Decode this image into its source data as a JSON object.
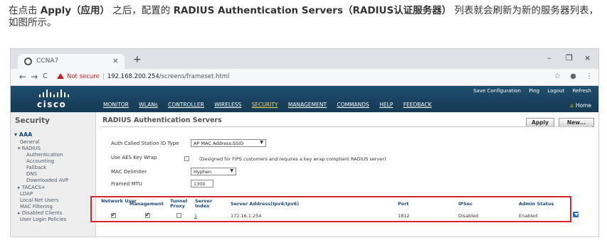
{
  "intro": {
    "p1": "在点击 ",
    "apply": "Apply（应用）",
    "p2": " 之后，配置的 ",
    "servers": "RADIUS Authentication Servers（RADIUS认证服务器）",
    "p3": " 列表就会刷新为新的服务器列表，如图所示。"
  },
  "browser": {
    "tab_title": "CCNA7",
    "tab_close": "×",
    "new_tab": "+",
    "minimize": "–",
    "restore": "❐",
    "close": "×",
    "back": "←",
    "forward": "→",
    "reload": "C",
    "not_secure": "Not secure",
    "url_host": "192.168.200.254",
    "url_path": "/screens/frameset.html",
    "star": "☆",
    "menu": "⋮"
  },
  "cisco": {
    "logo_text": "cisco",
    "menu": [
      "MONITOR",
      "WLANs",
      "CONTROLLER",
      "WIRELESS",
      "SECURITY",
      "MANAGEMENT",
      "COMMANDS",
      "HELP",
      "FEEDBACK"
    ],
    "active_menu": "SECURITY",
    "right_links": [
      "Save Configuration",
      "Ping",
      "Logout",
      "Refresh"
    ],
    "home": "Home"
  },
  "sidebar": {
    "title": "Security",
    "items": [
      {
        "label": "▾ AAA",
        "level": 0
      },
      {
        "label": "General",
        "level": 1
      },
      {
        "label": "▾ RADIUS",
        "level": 1
      },
      {
        "label": "Authentication",
        "level": 2
      },
      {
        "label": "Accounting",
        "level": 2
      },
      {
        "label": "Fallback",
        "level": 2
      },
      {
        "label": "DNS",
        "level": 2
      },
      {
        "label": "Downloaded AVP",
        "level": 2
      },
      {
        "label": "▸ TACACS+",
        "level": 1
      },
      {
        "label": "LDAP",
        "level": 1
      },
      {
        "label": "Local Net Users",
        "level": 1
      },
      {
        "label": "MAC Filtering",
        "level": 1
      },
      {
        "label": "▸ Disabled Clients",
        "level": 1
      },
      {
        "label": "User Login Policies",
        "level": 1
      }
    ]
  },
  "main": {
    "title": "RADIUS Authentication Servers",
    "apply_button": "Apply",
    "new_button": "New...",
    "fields": {
      "station_id_label": "Auth Called Station ID Type",
      "station_id_value": "AP MAC Address:SSID",
      "aes_label": "Use AES Key Wrap",
      "aes_note": "(Designed for FIPS customers and requires a key wrap compliant RADIUS server)",
      "mac_delim_label": "MAC Delimiter",
      "mac_delim_value": "Hyphen",
      "mtu_label": "Framed MTU",
      "mtu_value": "1300"
    },
    "table": {
      "headers": {
        "network_user": "Network User",
        "management": "Management",
        "tunnel_proxy": "Tunnel Proxy",
        "server_index": "Server Index",
        "server_address": "Server Address(Ipv4/Ipv6)",
        "port": "Port",
        "ipsec": "IPSec",
        "admin_status": "Admin Status"
      },
      "rows": [
        {
          "network_user": true,
          "management": true,
          "tunnel_proxy": false,
          "server_index": "1",
          "server_address": "172.16.1.254",
          "port": "1812",
          "ipsec": "Disabled",
          "admin_status": "Enabled"
        }
      ]
    }
  },
  "colors": {
    "header_bg": "#1f4e6e",
    "active_menu": "#ffd34d",
    "highlight_box": "#d6262c",
    "link": "#1a4a7a"
  }
}
